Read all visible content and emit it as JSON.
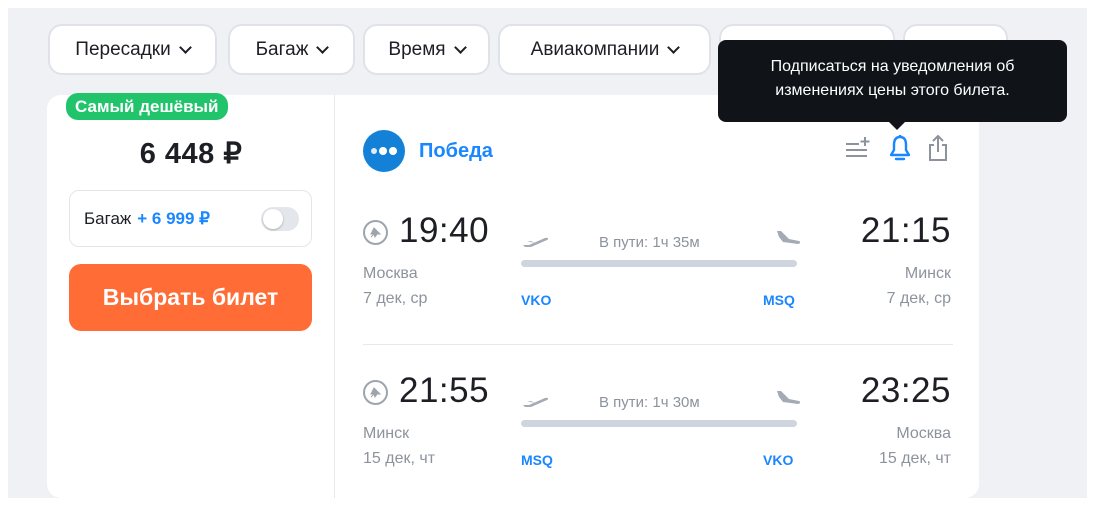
{
  "filters": [
    {
      "label": "Пересадки"
    },
    {
      "label": "Багаж"
    },
    {
      "label": "Время"
    },
    {
      "label": "Авиакомпании"
    },
    {
      "label": ""
    },
    {
      "label": ""
    }
  ],
  "tooltip": {
    "line1": "Подписаться на уведомления об",
    "line2": "изменениях цены этого билета."
  },
  "ticket": {
    "badge": "Самый дешёвый",
    "price": "6 448 ₽",
    "baggage": {
      "label": "Багаж",
      "extra": "+ 6 999 ₽"
    },
    "select_label": "Выбрать билет",
    "airline": "Победа",
    "colors": {
      "accent": "#1a86ff",
      "buy": "#ff6c36",
      "badge": "#21c36b",
      "airline_logo": "#1481d8"
    },
    "icons": [
      "add-to-list-icon",
      "bell-icon",
      "share-icon"
    ],
    "segments": [
      {
        "dep_time": "19:40",
        "dep_city": "Москва",
        "dep_date": "7 дек, ср",
        "dep_iata": "VKO",
        "duration": "В пути: 1ч 35м",
        "arr_time": "21:15",
        "arr_city": "Минск",
        "arr_date": "7 дек, ср",
        "arr_iata": "MSQ"
      },
      {
        "dep_time": "21:55",
        "dep_city": "Минск",
        "dep_date": "15 дек, чт",
        "dep_iata": "MSQ",
        "duration": "В пути: 1ч 30м",
        "arr_time": "23:25",
        "arr_city": "Москва",
        "arr_date": "15 дек, чт",
        "arr_iata": "VKO"
      }
    ]
  }
}
